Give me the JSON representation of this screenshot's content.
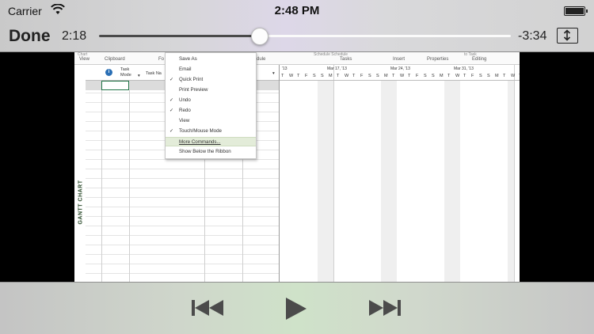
{
  "status_bar": {
    "carrier": "Carrier",
    "time": "2:48 PM"
  },
  "player": {
    "done_label": "Done",
    "elapsed": "2:18",
    "remaining": "-3:34",
    "progress_fraction": 0.39
  },
  "video": {
    "ribbon_groups": [
      "View",
      "Clipboard",
      "Fo",
      "dule",
      "Tasks",
      "Insert",
      "Properties",
      "Editing"
    ],
    "ribbon_partial_top": [
      "Chart",
      "Schedule  Schedule",
      "to Task"
    ],
    "side_label": "GANTT CHART",
    "table_headers": {
      "task_mode": "Task Mode",
      "task_name": "Task Na"
    },
    "timeline": {
      "weeks": [
        "'13",
        "Mar 17, '13",
        "Mar 24, '13",
        "Mar 31, '13"
      ],
      "days": [
        "T",
        "W",
        "T",
        "F",
        "S",
        "S",
        "M",
        "T",
        "W",
        "T",
        "F",
        "S",
        "S",
        "M",
        "T",
        "W",
        "T",
        "F",
        "S",
        "S",
        "M",
        "T",
        "W",
        "T",
        "F",
        "S",
        "S",
        "M",
        "T",
        "W",
        "T"
      ]
    },
    "menu": {
      "items": [
        {
          "label": "Save As",
          "checked": false
        },
        {
          "label": "Email",
          "checked": false
        },
        {
          "label": "Quick Print",
          "checked": true
        },
        {
          "label": "Print Preview",
          "checked": false
        },
        {
          "label": "Undo",
          "checked": true
        },
        {
          "label": "Redo",
          "checked": true
        },
        {
          "label": "View",
          "checked": false
        },
        {
          "label": "Touch/Mouse Mode",
          "checked": true
        },
        {
          "label": "More Commands...",
          "checked": false,
          "highlighted": true
        },
        {
          "label": "Show Below the Ribbon",
          "checked": false
        }
      ]
    }
  },
  "controls": {
    "rewind_icon": "skip-back-icon",
    "play_icon": "play-icon",
    "forward_icon": "skip-forward-icon"
  }
}
